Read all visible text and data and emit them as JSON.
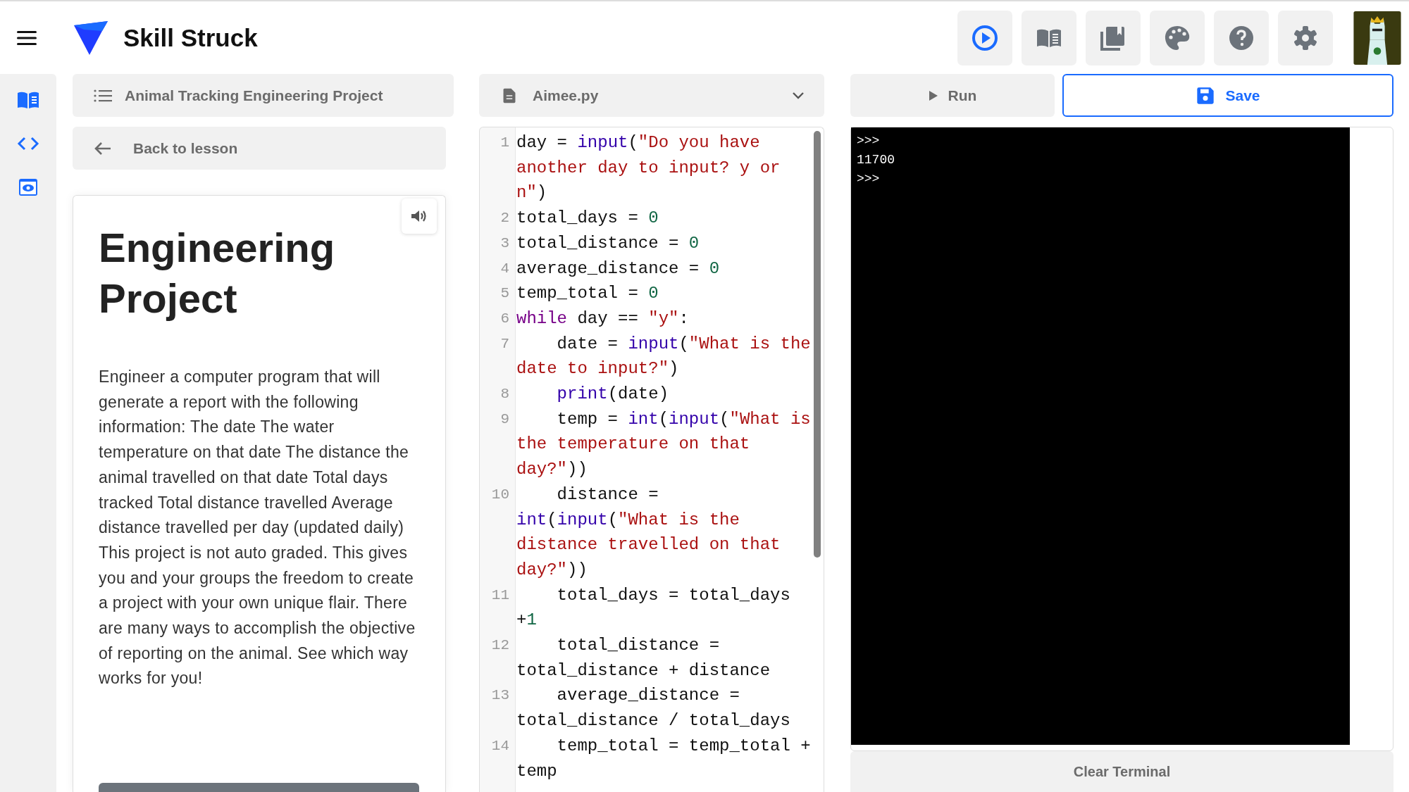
{
  "header": {
    "logo_text": "Skill Struck"
  },
  "lesson_panel": {
    "project_title": "Animal Tracking Engineering Project",
    "back_link": "Back to lesson",
    "heading": "Engineering Project",
    "description": "Engineer a computer program that will generate a report with the following information: The date The water temperature on that date The distance the animal travelled on that date Total days tracked Total distance travelled Average distance travelled per day (updated daily) This project is not auto graded. This gives you and your groups the freedom to create a project with your own unique flair. There are many ways to accomplish the objective of reporting on the animal. See which way works for you!"
  },
  "editor": {
    "file_name": "Aimee.py",
    "lines": [
      {
        "number": "1",
        "indented": false,
        "tokens": [
          {
            "kind": "plain",
            "text": "day = "
          },
          {
            "kind": "builtin",
            "text": "input"
          },
          {
            "kind": "plain",
            "text": "("
          },
          {
            "kind": "string",
            "text": "\"Do you have another day to input? y or n\""
          },
          {
            "kind": "plain",
            "text": ")"
          }
        ]
      },
      {
        "number": "2",
        "indented": false,
        "tokens": [
          {
            "kind": "plain",
            "text": "total_days = "
          },
          {
            "kind": "number",
            "text": "0"
          }
        ]
      },
      {
        "number": "3",
        "indented": false,
        "tokens": [
          {
            "kind": "plain",
            "text": "total_distance = "
          },
          {
            "kind": "number",
            "text": "0"
          }
        ]
      },
      {
        "number": "4",
        "indented": false,
        "tokens": [
          {
            "kind": "plain",
            "text": "average_distance = "
          },
          {
            "kind": "number",
            "text": "0"
          }
        ]
      },
      {
        "number": "5",
        "indented": false,
        "tokens": [
          {
            "kind": "plain",
            "text": "temp_total = "
          },
          {
            "kind": "number",
            "text": "0"
          }
        ]
      },
      {
        "number": "6",
        "indented": false,
        "tokens": [
          {
            "kind": "keyword",
            "text": "while"
          },
          {
            "kind": "plain",
            "text": " day == "
          },
          {
            "kind": "string",
            "text": "\"y\""
          },
          {
            "kind": "plain",
            "text": ":"
          }
        ]
      },
      {
        "number": "7",
        "indented": true,
        "tokens": [
          {
            "kind": "plain",
            "text": "date = "
          },
          {
            "kind": "builtin",
            "text": "input"
          },
          {
            "kind": "plain",
            "text": "("
          },
          {
            "kind": "string",
            "text": "\"What is the date to input?\""
          },
          {
            "kind": "plain",
            "text": ")"
          }
        ]
      },
      {
        "number": "8",
        "indented": true,
        "tokens": [
          {
            "kind": "builtin",
            "text": "print"
          },
          {
            "kind": "plain",
            "text": "(date)"
          }
        ]
      },
      {
        "number": "9",
        "indented": true,
        "tokens": [
          {
            "kind": "plain",
            "text": "temp = "
          },
          {
            "kind": "builtin",
            "text": "int"
          },
          {
            "kind": "plain",
            "text": "("
          },
          {
            "kind": "builtin",
            "text": "input"
          },
          {
            "kind": "plain",
            "text": "("
          },
          {
            "kind": "string",
            "text": "\"What is the temperature on that day?\""
          },
          {
            "kind": "plain",
            "text": "))"
          }
        ]
      },
      {
        "number": "10",
        "indented": true,
        "tokens": [
          {
            "kind": "plain",
            "text": "distance = "
          },
          {
            "kind": "builtin",
            "text": "int"
          },
          {
            "kind": "plain",
            "text": "("
          },
          {
            "kind": "builtin",
            "text": "input"
          },
          {
            "kind": "plain",
            "text": "("
          },
          {
            "kind": "string",
            "text": "\"What is the distance travelled on that day?\""
          },
          {
            "kind": "plain",
            "text": "))"
          }
        ]
      },
      {
        "number": "11",
        "indented": true,
        "tokens": [
          {
            "kind": "plain",
            "text": "total_days = total_days +"
          },
          {
            "kind": "number",
            "text": "1"
          }
        ]
      },
      {
        "number": "12",
        "indented": true,
        "tokens": [
          {
            "kind": "plain",
            "text": "total_distance = total_distance + distance"
          }
        ]
      },
      {
        "number": "13",
        "indented": true,
        "tokens": [
          {
            "kind": "plain",
            "text": "average_distance = total_distance / total_days"
          }
        ]
      },
      {
        "number": "14",
        "indented": true,
        "tokens": [
          {
            "kind": "plain",
            "text": "temp_total = temp_total + temp"
          }
        ]
      }
    ]
  },
  "run_button": "Run",
  "save_button": "Save",
  "terminal": {
    "lines": [
      ">>>",
      "11700",
      ">>>"
    ]
  },
  "clear_button": "Clear Terminal"
}
